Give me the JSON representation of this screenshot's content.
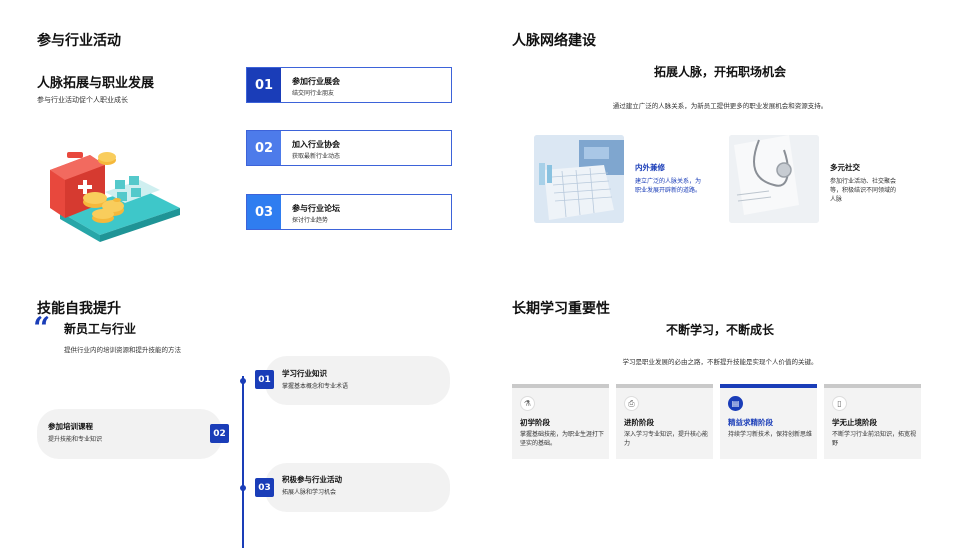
{
  "tl": {
    "title": "参与行业活动",
    "subtitle": "人脉拓展与职业发展",
    "desc": "参与行业活动促个人职业成长",
    "steps": [
      {
        "num": "01",
        "title": "参加行业展会",
        "sub": "结交同行业朋友"
      },
      {
        "num": "02",
        "title": "加入行业协会",
        "sub": "获取最新行业动态"
      },
      {
        "num": "03",
        "title": "参与行业论坛",
        "sub": "探讨行业趋势"
      }
    ]
  },
  "tr": {
    "title": "人脉网络建设",
    "headline": "拓展人脉，开拓职场机会",
    "desc": "通过建立广泛的人脉关系，为新员工提供更多的职业发展机会和资源支持。",
    "cards": [
      {
        "title": "内外兼修",
        "desc": "建立广泛的人脉关系，为职业发展开辟新的道路。"
      },
      {
        "title": "多元社交",
        "desc": "参加行业活动、社交聚会等，积极结识不同领域的人脉"
      }
    ]
  },
  "bl": {
    "title": "技能自我提升",
    "quote_mark": "“",
    "subtitle": "新员工与行业",
    "desc": "提供行业内的培训资源和提升技能的方法",
    "items": [
      {
        "num": "01",
        "title": "学习行业知识",
        "sub": "掌握基本概念和专业术语"
      },
      {
        "num": "02",
        "title": "参加培训课程",
        "sub": "提升技能和专业知识"
      },
      {
        "num": "03",
        "title": "积极参与行业活动",
        "sub": "拓展人脉和学习机会"
      }
    ]
  },
  "br": {
    "title": "长期学习重要性",
    "headline": "不断学习，不断成长",
    "desc": "学习是职业发展的必由之路，不断提升技能是实现个人价值的关键。",
    "stages": [
      {
        "icon": "flask-icon",
        "title": "初学阶段",
        "desc": "掌握基础技能，为职业生涯打下坚实的基础。"
      },
      {
        "icon": "printer-icon",
        "title": "进阶阶段",
        "desc": "深入学习专业知识，提升核心能力"
      },
      {
        "icon": "chat-icon",
        "title": "精益求精阶段",
        "desc": "持续学习新技术，保持创新思维"
      },
      {
        "icon": "document-icon",
        "title": "学无止境阶段",
        "desc": "不断学习行业前沿知识，拓宽视野"
      }
    ]
  },
  "colors": {
    "primary": "#1a3db8",
    "mid": "#3d63d9",
    "light": "#2f7df0",
    "accent_text": "#1a3db8"
  }
}
